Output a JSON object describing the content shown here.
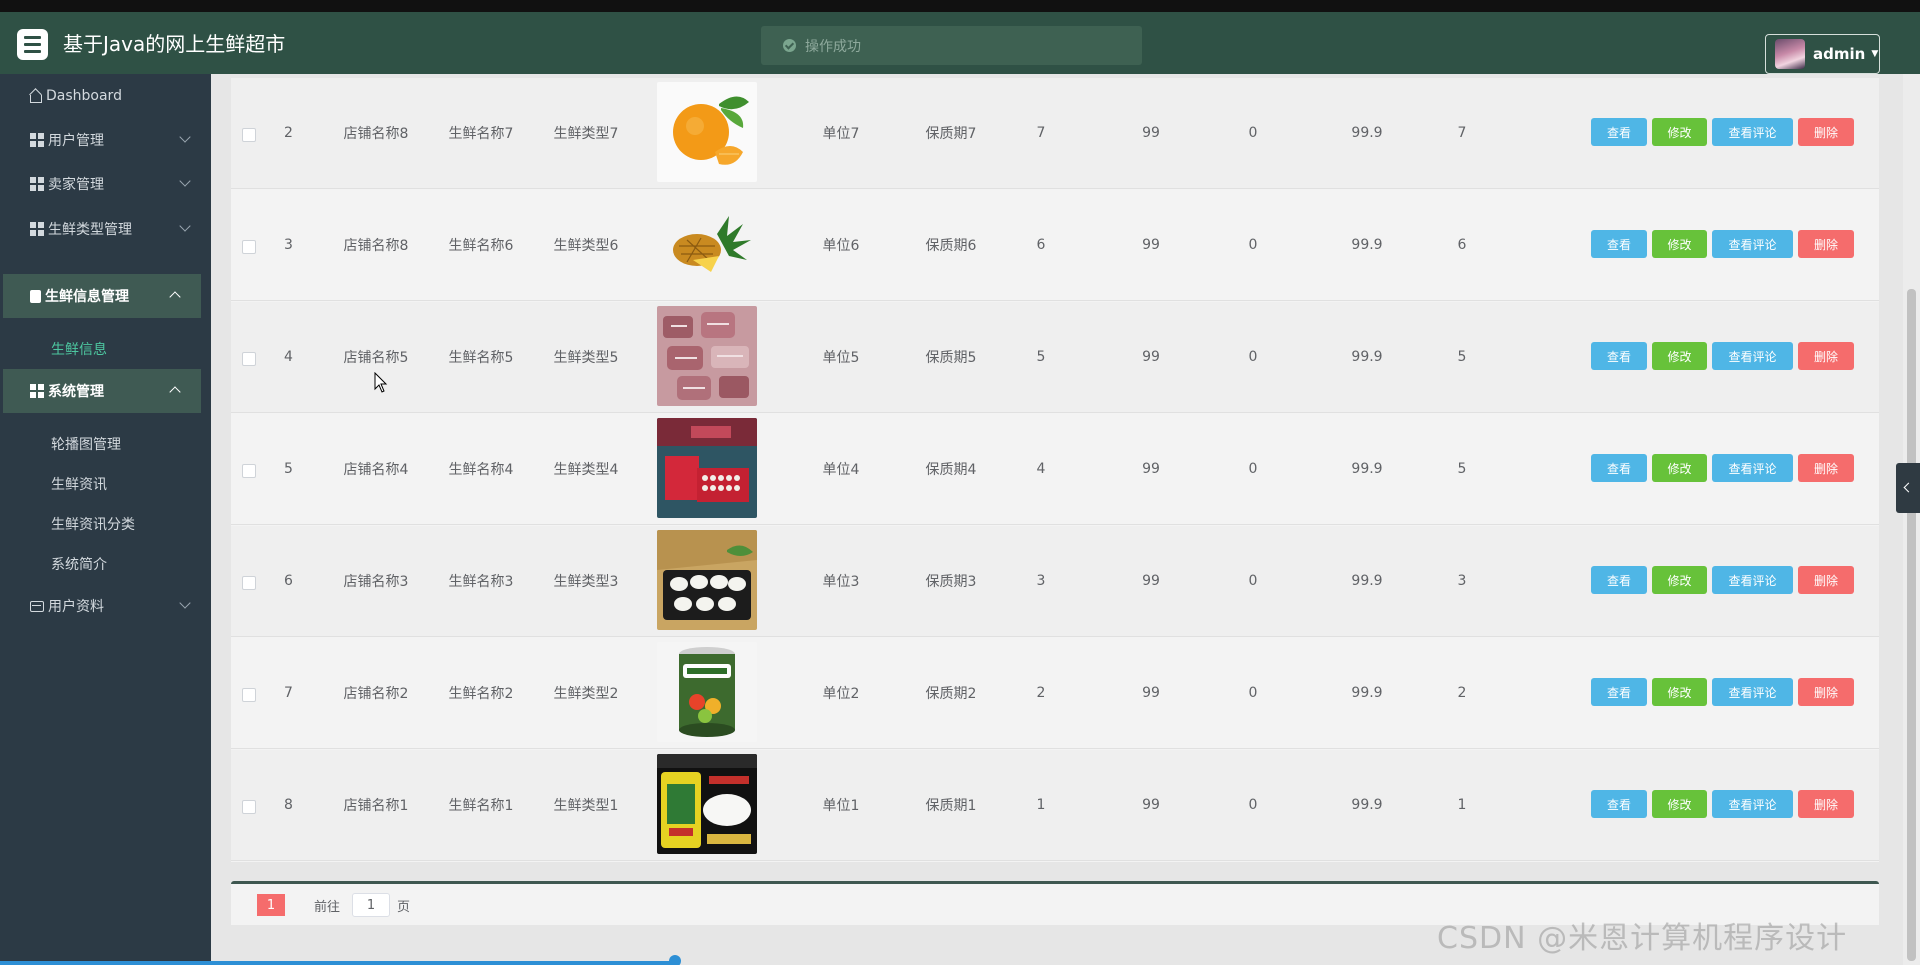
{
  "header": {
    "title": "基于Java的网上生鲜超市",
    "toast": "操作成功",
    "user": "admin"
  },
  "sidebar": {
    "items": [
      {
        "label": "Dashboard"
      },
      {
        "label": "用户管理"
      },
      {
        "label": "卖家管理"
      },
      {
        "label": "生鲜类型管理"
      },
      {
        "label": "生鲜信息管理"
      },
      {
        "label": "系统管理"
      },
      {
        "label": "用户资料"
      }
    ],
    "sub_fresh": [
      "生鲜信息"
    ],
    "sub_system": [
      "轮播图管理",
      "生鲜资讯",
      "生鲜资讯分类",
      "系统简介"
    ]
  },
  "actions": {
    "view": "查看",
    "edit": "修改",
    "comments": "查看评论",
    "delete": "删除"
  },
  "table": {
    "rows": [
      {
        "id": "2",
        "shop": "店铺名称8",
        "name": "生鲜名称7",
        "type": "生鲜类型7",
        "unit": "单位7",
        "shelf": "保质期7",
        "qty": "7",
        "c1": "99",
        "c2": "0",
        "price": "99.9",
        "c3": "7",
        "image": "orange"
      },
      {
        "id": "3",
        "shop": "店铺名称8",
        "name": "生鲜名称6",
        "type": "生鲜类型6",
        "unit": "单位6",
        "shelf": "保质期6",
        "qty": "6",
        "c1": "99",
        "c2": "0",
        "price": "99.9",
        "c3": "6",
        "image": "pineapple"
      },
      {
        "id": "4",
        "shop": "店铺名称5",
        "name": "生鲜名称5",
        "type": "生鲜类型5",
        "unit": "单位5",
        "shelf": "保质期5",
        "qty": "5",
        "c1": "99",
        "c2": "0",
        "price": "99.9",
        "c3": "5",
        "image": "meat"
      },
      {
        "id": "5",
        "shop": "店铺名称4",
        "name": "生鲜名称4",
        "type": "生鲜类型4",
        "unit": "单位4",
        "shelf": "保质期4",
        "qty": "4",
        "c1": "99",
        "c2": "0",
        "price": "99.9",
        "c3": "5",
        "image": "gift-box"
      },
      {
        "id": "6",
        "shop": "店铺名称3",
        "name": "生鲜名称3",
        "type": "生鲜类型3",
        "unit": "单位3",
        "shelf": "保质期3",
        "qty": "3",
        "c1": "99",
        "c2": "0",
        "price": "99.9",
        "c3": "3",
        "image": "dumplings"
      },
      {
        "id": "7",
        "shop": "店铺名称2",
        "name": "生鲜名称2",
        "type": "生鲜类型2",
        "unit": "单位2",
        "shelf": "保质期2",
        "qty": "2",
        "c1": "99",
        "c2": "0",
        "price": "99.9",
        "c3": "2",
        "image": "can"
      },
      {
        "id": "8",
        "shop": "店铺名称1",
        "name": "生鲜名称1",
        "type": "生鲜类型1",
        "unit": "单位1",
        "shelf": "保质期1",
        "qty": "1",
        "c1": "99",
        "c2": "0",
        "price": "99.9",
        "c3": "1",
        "image": "rice-bag"
      }
    ]
  },
  "pagination": {
    "current": "1",
    "goto_label": "前往",
    "goto_value": "1",
    "unit": "页"
  },
  "watermark": "CSDN @米恩计算机程序设计",
  "colors": {
    "header": "#2f5145",
    "sidebar": "#2c3a45",
    "accent": "#4dc7a0",
    "view": "#4fb6e6",
    "edit": "#67c23a",
    "delete": "#f56c6c"
  }
}
